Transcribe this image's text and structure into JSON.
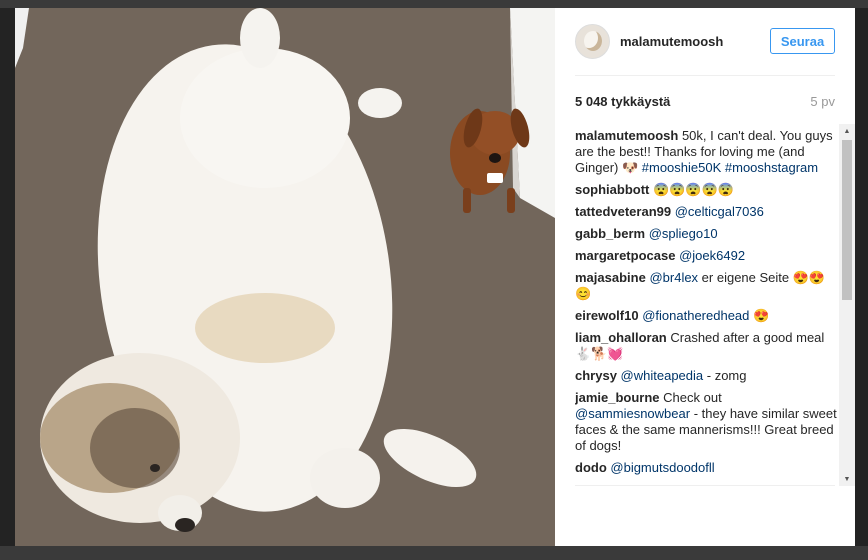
{
  "post": {
    "username": "malamutemoosh",
    "follow_label": "Seuraa",
    "likes": "5 048 tykkäystä",
    "time": "5 pv"
  },
  "comments": [
    {
      "author": "malamutemoosh",
      "parts": [
        {
          "t": "50k, I can't deal. You guys are the best!! Thanks for loving me (and Ginger) 🐶 ",
          "link": false
        },
        {
          "t": "#mooshie50K",
          "link": true
        },
        {
          "t": " ",
          "link": false
        },
        {
          "t": "#mooshstagram",
          "link": true
        }
      ]
    },
    {
      "author": "sophiabbott",
      "parts": [
        {
          "t": "😨😨😨😨😨",
          "link": false
        }
      ]
    },
    {
      "author": "tattedveteran99",
      "parts": [
        {
          "t": "@celticgal7036",
          "link": true
        }
      ]
    },
    {
      "author": "gabb_berm",
      "parts": [
        {
          "t": "@spliego10",
          "link": true
        }
      ]
    },
    {
      "author": "margaretpocase",
      "parts": [
        {
          "t": "@joek6492",
          "link": true
        }
      ]
    },
    {
      "author": "majasabine",
      "parts": [
        {
          "t": "@br4lex",
          "link": true
        },
        {
          "t": " er eigene Seite 😍😍😊",
          "link": false
        }
      ]
    },
    {
      "author": "eirewolf10",
      "parts": [
        {
          "t": "@fionatheredhead",
          "link": true
        },
        {
          "t": " 😍",
          "link": false
        }
      ]
    },
    {
      "author": "liam_ohalloran",
      "parts": [
        {
          "t": "Crashed after a good meal 🐇🐕💓",
          "link": false
        }
      ]
    },
    {
      "author": "chrysy",
      "parts": [
        {
          "t": "@whiteapedia",
          "link": true
        },
        {
          "t": " - zomg",
          "link": false
        }
      ]
    },
    {
      "author": "jamie_bourne",
      "parts": [
        {
          "t": "Check out ",
          "link": false
        },
        {
          "t": "@sammiesnowbear",
          "link": true
        },
        {
          "t": " - they have similar sweet faces & the same mannerisms!!! Great breed of dogs!",
          "link": false
        }
      ]
    },
    {
      "author": "dodo",
      "parts": [
        {
          "t": "@bigmutsdoodofll",
          "link": true
        }
      ]
    }
  ],
  "icons": {
    "scroll_up": "triangle-up-icon",
    "scroll_down": "triangle-down-icon"
  }
}
